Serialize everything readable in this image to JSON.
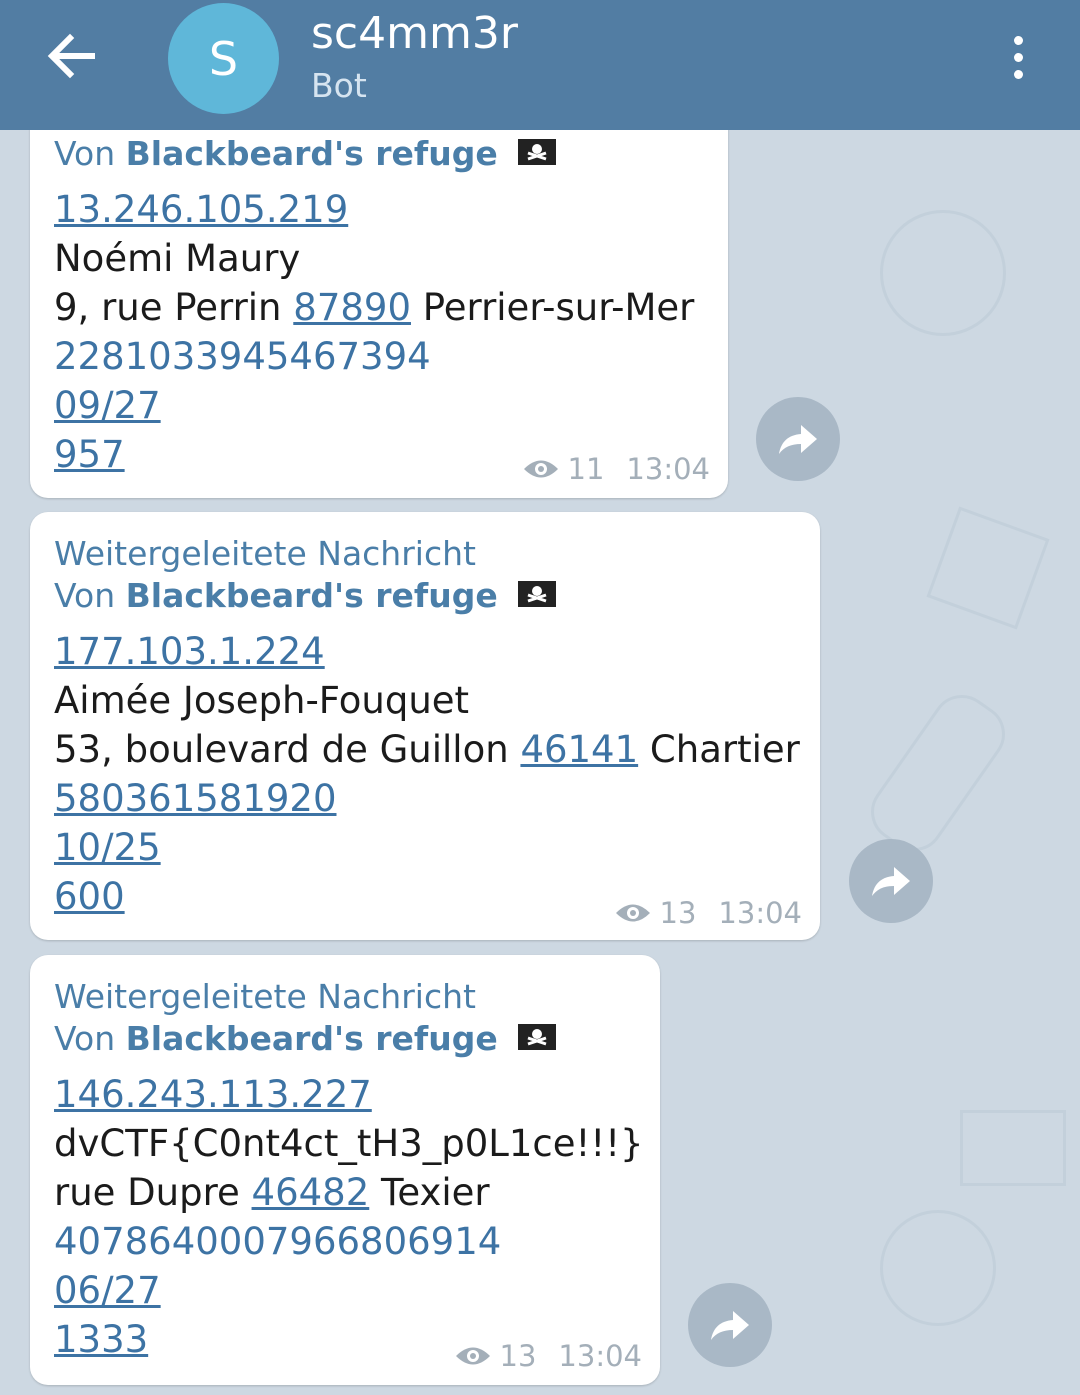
{
  "header": {
    "back_icon": "arrow-left-icon",
    "avatar_letter": "S",
    "title": "sc4mm3r",
    "subtitle": "Bot",
    "menu_icon": "more-vertical-icon"
  },
  "messages": [
    {
      "forwarded_label": "",
      "from_prefix": "Von",
      "from_name": "Blackbeard's refuge",
      "ip": "13.246.105.219",
      "name": "Noémi Maury",
      "street": "9, rue Perrin",
      "zip": "87890",
      "city": "Perrier-sur-Mer",
      "card": "2281033945467394",
      "expiry": "09/27",
      "cvv": "957",
      "views": "11",
      "time": "13:04"
    },
    {
      "forwarded_label": "Weitergeleitete Nachricht",
      "from_prefix": "Von",
      "from_name": "Blackbeard's refuge",
      "ip": "177.103.1.224",
      "name": "Aimée Joseph-Fouquet",
      "street": "53, boulevard de Guillon",
      "zip": "46141",
      "city": "Chartier",
      "card": "580361581920",
      "expiry": "10/25",
      "cvv": "600",
      "views": "13",
      "time": "13:04"
    },
    {
      "forwarded_label": "Weitergeleitete Nachricht",
      "from_prefix": "Von",
      "from_name": "Blackbeard's refuge",
      "ip": "146.243.113.227",
      "name": "dvCTF{C0nt4ct_tH3_p0L1ce!!!}",
      "street": "rue Dupre",
      "zip": "46482",
      "city": "Texier",
      "card": "4078640007966806914",
      "expiry": "06/27",
      "cvv": "1333",
      "views": "13",
      "time": "13:04"
    }
  ],
  "colors": {
    "header": "#527da3",
    "link": "#3d73a4",
    "avatar": "#5fb7d9",
    "wallpaper": "#cdd8e2"
  }
}
